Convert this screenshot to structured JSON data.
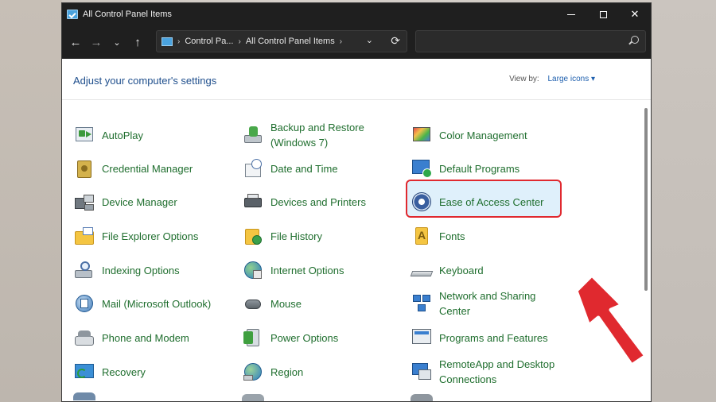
{
  "window": {
    "title": "All Control Panel Items"
  },
  "address": {
    "crumbs": [
      "Control Pa...",
      "All Control Panel Items"
    ],
    "search_placeholder": ""
  },
  "header": {
    "heading": "Adjust your computer's settings",
    "view_by_label": "View by:",
    "view_by_value": "Large icons ▾"
  },
  "items": [
    {
      "label": "AutoPlay",
      "icon": "autoplay-icon"
    },
    {
      "label": "Backup and Restore\n(Windows 7)",
      "icon": "backup-restore-icon"
    },
    {
      "label": "Color Management",
      "icon": "color-management-icon"
    },
    {
      "label": "Credential Manager",
      "icon": "credential-manager-icon"
    },
    {
      "label": "Date and Time",
      "icon": "date-time-icon"
    },
    {
      "label": "Default Programs",
      "icon": "default-programs-icon"
    },
    {
      "label": "Device Manager",
      "icon": "device-manager-icon"
    },
    {
      "label": "Devices and Printers",
      "icon": "devices-printers-icon"
    },
    {
      "label": "Ease of Access Center",
      "icon": "ease-of-access-icon"
    },
    {
      "label": "File Explorer Options",
      "icon": "file-explorer-options-icon"
    },
    {
      "label": "File History",
      "icon": "file-history-icon"
    },
    {
      "label": "Fonts",
      "icon": "fonts-icon"
    },
    {
      "label": "Indexing Options",
      "icon": "indexing-options-icon"
    },
    {
      "label": "Internet Options",
      "icon": "internet-options-icon"
    },
    {
      "label": "Keyboard",
      "icon": "keyboard-icon"
    },
    {
      "label": "Mail (Microsoft Outlook)",
      "icon": "mail-icon"
    },
    {
      "label": "Mouse",
      "icon": "mouse-icon"
    },
    {
      "label": "Network and Sharing\nCenter",
      "icon": "network-sharing-icon"
    },
    {
      "label": "Phone and Modem",
      "icon": "phone-modem-icon"
    },
    {
      "label": "Power Options",
      "icon": "power-options-icon"
    },
    {
      "label": "Programs and Features",
      "icon": "programs-features-icon"
    },
    {
      "label": "Recovery",
      "icon": "recovery-icon"
    },
    {
      "label": "Region",
      "icon": "region-icon"
    },
    {
      "label": "RemoteApp and Desktop\nConnections",
      "icon": "remoteapp-icon"
    }
  ],
  "colors": {
    "link_green": "#1f6e2e",
    "heading_blue": "#1e4e8c",
    "highlight_red": "#e0292f",
    "highlight_fill": "#dff0fb",
    "titlebar": "#1f1f1f"
  }
}
